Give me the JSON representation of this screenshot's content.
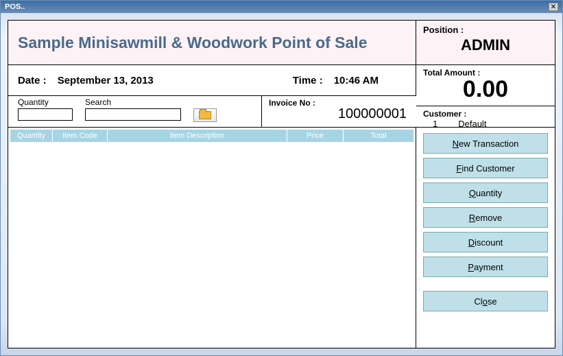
{
  "window_title": "POS..",
  "header": {
    "app_title": "Sample Minisawmill & Woodwork Point of Sale",
    "position_label": "Position :",
    "position_value": "ADMIN"
  },
  "datetime": {
    "date_label": "Date :",
    "date_value": "September 13, 2013",
    "time_label": "Time :",
    "time_value": "10:46 AM"
  },
  "totals": {
    "total_label": "Total Amount :",
    "total_value": "0.00",
    "customer_label": "Customer :",
    "customer_id": "1",
    "customer_name": "Default"
  },
  "inputs": {
    "quantity_label": "Quantity",
    "quantity_value": "",
    "search_label": "Search",
    "search_value": ""
  },
  "invoice": {
    "label": "Invoice No :",
    "value": "100000001"
  },
  "grid_headers": {
    "qty": "Quantity",
    "code": "Item Code",
    "desc": "Item Description",
    "price": "Price",
    "total": "Total"
  },
  "grid_rows": [],
  "buttons": {
    "new_transaction": {
      "pre": "",
      "u": "N",
      "post": "ew Transaction"
    },
    "find_customer": {
      "pre": "",
      "u": "F",
      "post": "ind Customer"
    },
    "quantity": {
      "pre": "",
      "u": "Q",
      "post": "uantity"
    },
    "remove": {
      "pre": "",
      "u": "R",
      "post": "emove"
    },
    "discount": {
      "pre": "",
      "u": "D",
      "post": "iscount"
    },
    "payment": {
      "pre": "",
      "u": "P",
      "post": "ayment"
    },
    "close": {
      "pre": "Cl",
      "u": "o",
      "post": "se"
    }
  }
}
